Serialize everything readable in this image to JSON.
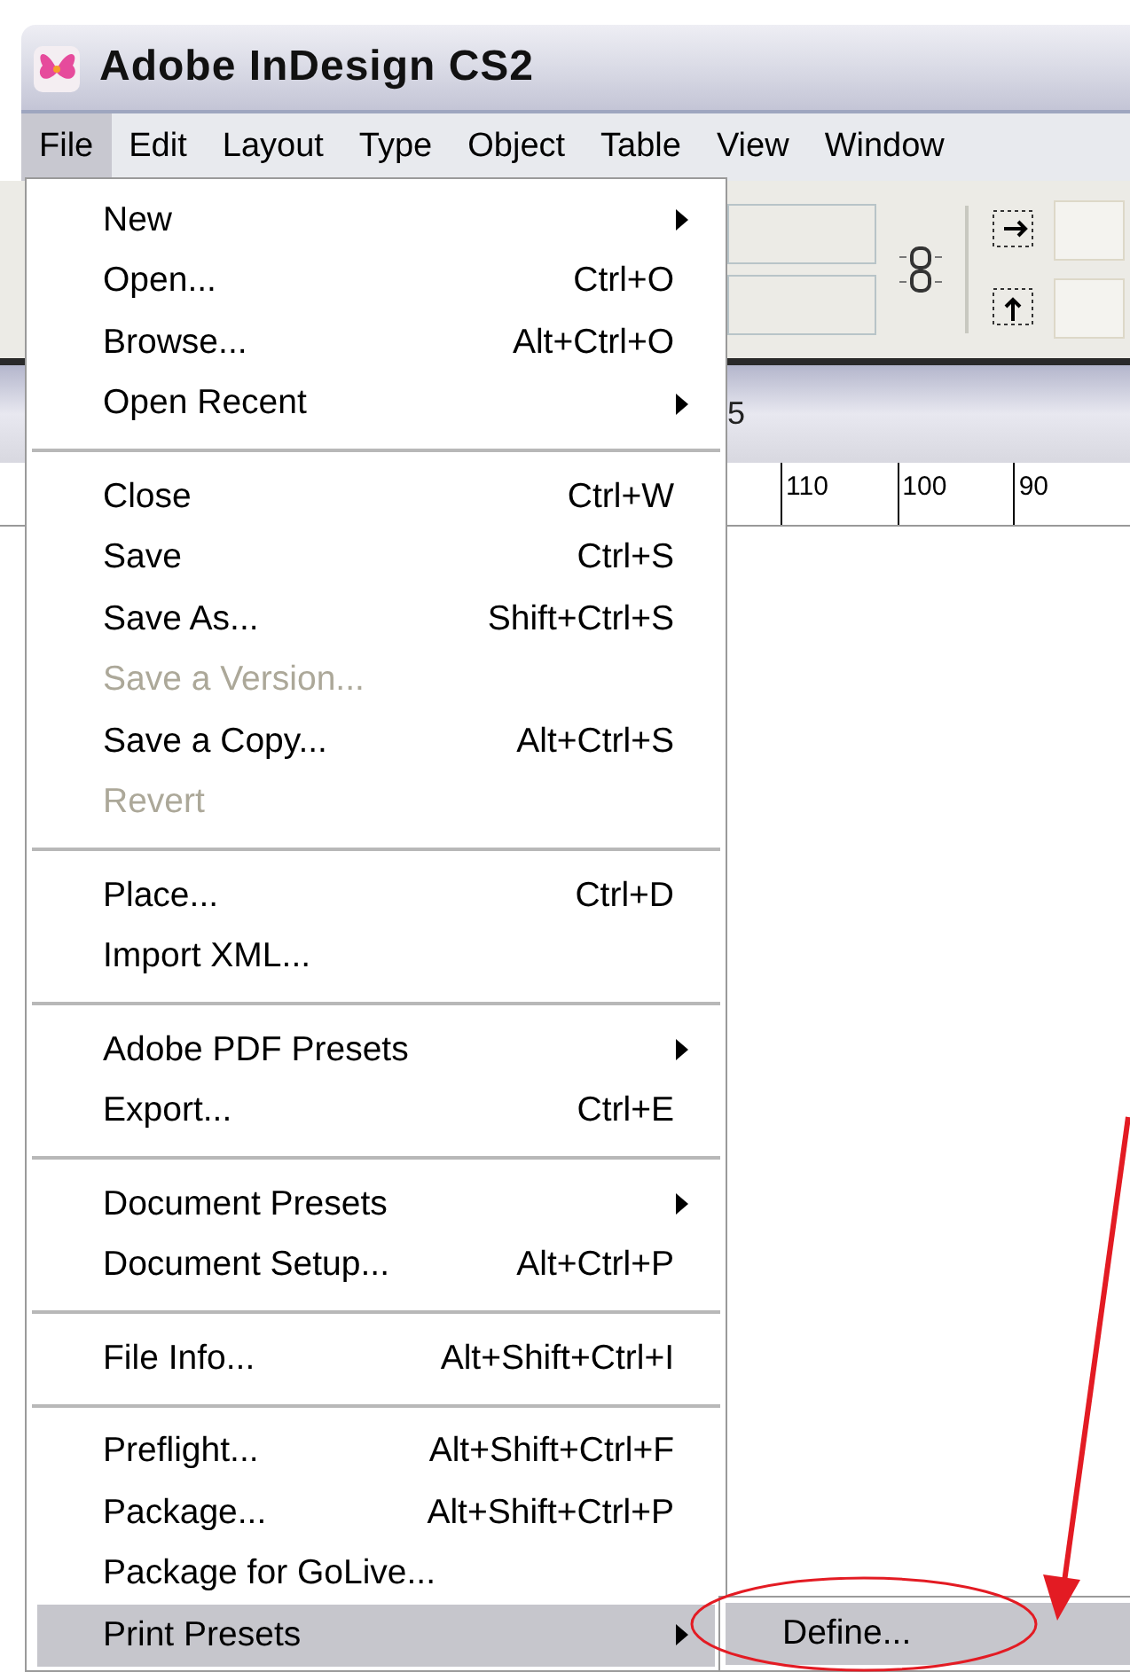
{
  "window": {
    "title": "Adobe InDesign CS2"
  },
  "menubar": [
    {
      "label": "File",
      "selected": true
    },
    {
      "label": "Edit",
      "selected": false
    },
    {
      "label": "Layout",
      "selected": false
    },
    {
      "label": "Type",
      "selected": false
    },
    {
      "label": "Object",
      "selected": false
    },
    {
      "label": "Table",
      "selected": false
    },
    {
      "label": "View",
      "selected": false
    },
    {
      "label": "Window",
      "selected": false
    }
  ],
  "file_menu": [
    [
      {
        "label": "New",
        "submenu": true,
        "disabled": false,
        "selected": false
      },
      {
        "label": "Open...",
        "shortcut": "Ctrl+O",
        "submenu": false,
        "disabled": false,
        "selected": false
      },
      {
        "label": "Browse...",
        "shortcut": "Alt+Ctrl+O",
        "submenu": false,
        "disabled": false,
        "selected": false
      },
      {
        "label": "Open Recent",
        "submenu": true,
        "disabled": false,
        "selected": false
      }
    ],
    [
      {
        "label": "Close",
        "shortcut": "Ctrl+W",
        "submenu": false,
        "disabled": false,
        "selected": false
      },
      {
        "label": "Save",
        "shortcut": "Ctrl+S",
        "submenu": false,
        "disabled": false,
        "selected": false
      },
      {
        "label": "Save As...",
        "shortcut": "Shift+Ctrl+S",
        "submenu": false,
        "disabled": false,
        "selected": false
      },
      {
        "label": "Save a Version...",
        "submenu": false,
        "disabled": true,
        "selected": false
      },
      {
        "label": "Save a Copy...",
        "shortcut": "Alt+Ctrl+S",
        "submenu": false,
        "disabled": false,
        "selected": false
      },
      {
        "label": "Revert",
        "submenu": false,
        "disabled": true,
        "selected": false
      }
    ],
    [
      {
        "label": "Place...",
        "shortcut": "Ctrl+D",
        "submenu": false,
        "disabled": false,
        "selected": false
      },
      {
        "label": "Import XML...",
        "submenu": false,
        "disabled": false,
        "selected": false
      }
    ],
    [
      {
        "label": "Adobe PDF Presets",
        "submenu": true,
        "disabled": false,
        "selected": false
      },
      {
        "label": "Export...",
        "shortcut": "Ctrl+E",
        "submenu": false,
        "disabled": false,
        "selected": false
      }
    ],
    [
      {
        "label": "Document Presets",
        "submenu": true,
        "disabled": false,
        "selected": false
      },
      {
        "label": "Document Setup...",
        "shortcut": "Alt+Ctrl+P",
        "submenu": false,
        "disabled": false,
        "selected": false
      }
    ],
    [
      {
        "label": "File Info...",
        "shortcut": "Alt+Shift+Ctrl+I",
        "submenu": false,
        "disabled": false,
        "selected": false
      }
    ],
    [
      {
        "label": "Preflight...",
        "shortcut": "Alt+Shift+Ctrl+F",
        "submenu": false,
        "disabled": false,
        "selected": false
      },
      {
        "label": "Package...",
        "shortcut": "Alt+Shift+Ctrl+P",
        "submenu": false,
        "disabled": false,
        "selected": false
      },
      {
        "label": "Package for GoLive...",
        "submenu": false,
        "disabled": false,
        "selected": false
      },
      {
        "label": "Print Presets",
        "submenu": true,
        "disabled": false,
        "selected": true
      }
    ]
  ],
  "submenu": [
    {
      "label": "Define...",
      "selected": true
    }
  ],
  "document_tab": {
    "label": "5"
  },
  "ruler": {
    "labels": [
      "110",
      "100",
      "90"
    ]
  }
}
